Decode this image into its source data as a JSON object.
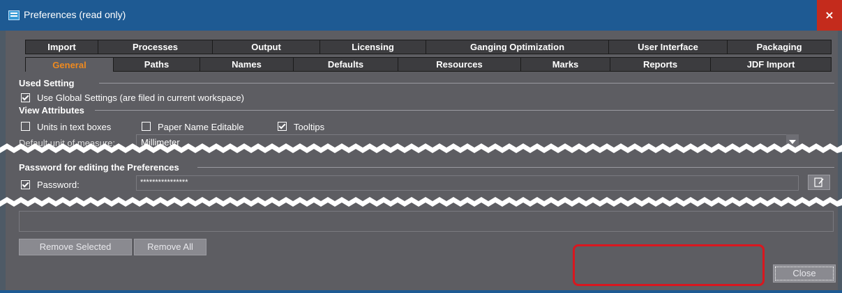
{
  "window": {
    "title": "Preferences (read only)",
    "close_glyph": "×"
  },
  "tabs_row1": [
    {
      "label": "Import"
    },
    {
      "label": "Processes"
    },
    {
      "label": "Output"
    },
    {
      "label": "Licensing"
    },
    {
      "label": "Ganging Optimization"
    },
    {
      "label": "User Interface"
    },
    {
      "label": "Packaging"
    }
  ],
  "tabs_row2": [
    {
      "label": "General",
      "active": true
    },
    {
      "label": "Paths"
    },
    {
      "label": "Names"
    },
    {
      "label": "Defaults"
    },
    {
      "label": "Resources"
    },
    {
      "label": "Marks"
    },
    {
      "label": "Reports"
    },
    {
      "label": "JDF Import"
    }
  ],
  "used_setting": {
    "title": "Used Setting",
    "use_global": {
      "label": "Use Global Settings (are filed in current workspace)",
      "checked": true
    }
  },
  "view_attributes": {
    "title": "View Attributes",
    "units_in_text_boxes": {
      "label": "Units in text boxes",
      "checked": false
    },
    "paper_name_editable": {
      "label": "Paper Name Editable",
      "checked": false
    },
    "tooltips": {
      "label": "Tooltips",
      "checked": true
    },
    "default_unit_label": "Default unit of measure:",
    "default_unit_value": "Millimeter"
  },
  "password_section": {
    "title": "Password for editing the Preferences",
    "password_label": "Password:",
    "password_checked": true,
    "password_value": "****************"
  },
  "buttons": {
    "remove_selected": "Remove Selected",
    "remove_all": "Remove All",
    "close": "Close"
  },
  "colors": {
    "title_bar": "#1e5a93",
    "background": "#5d5d62",
    "active_tab_text": "#ef8a1f",
    "highlight": "#d9171f"
  }
}
